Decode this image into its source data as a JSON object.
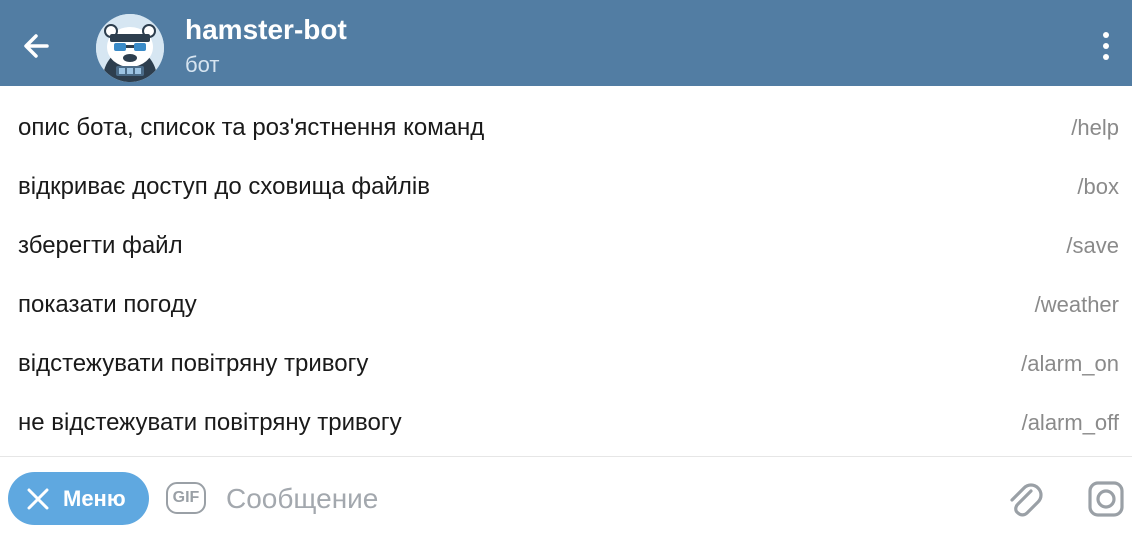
{
  "header": {
    "title": "hamster-bot",
    "subtitle": "бот",
    "back_icon": "arrow-left-icon",
    "more_icon": "more-vertical-icon",
    "avatar": "bot-avatar"
  },
  "commands": [
    {
      "description": "опис бота, список та роз'ястнення команд",
      "command": "/help"
    },
    {
      "description": "відкриває доступ до сховища файлів",
      "command": "/box"
    },
    {
      "description": "зберегти файл",
      "command": "/save"
    },
    {
      "description": "показати погоду",
      "command": "/weather"
    },
    {
      "description": "відстежувати повітряну тривогу",
      "command": "/alarm_on"
    },
    {
      "description": "не відстежувати повітряну тривогу",
      "command": "/alarm_off"
    }
  ],
  "input_bar": {
    "menu_label": "Меню",
    "gif_label": "GIF",
    "message_placeholder": "Сообщение",
    "message_value": ""
  },
  "colors": {
    "header_bg": "#527da3",
    "menu_button_bg": "#5fa8e0",
    "command_text": "#8a8a8a"
  }
}
